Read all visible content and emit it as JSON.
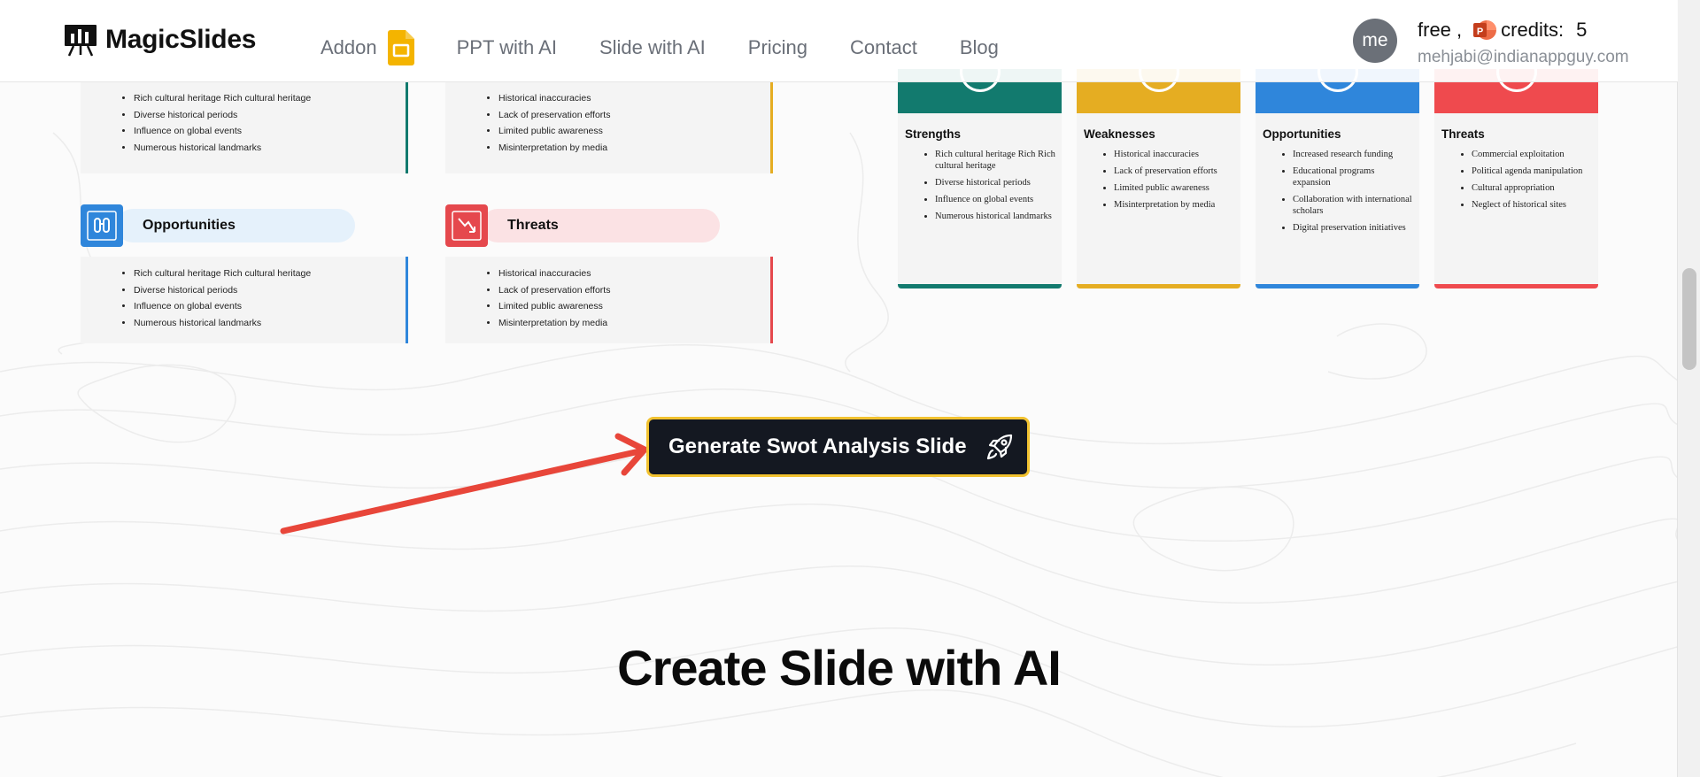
{
  "header": {
    "brand": "MagicSlides",
    "nav": {
      "addon": "Addon",
      "ppt_with_ai": "PPT with AI",
      "slide_with_ai": "Slide with AI",
      "pricing": "Pricing",
      "contact": "Contact",
      "blog": "Blog"
    },
    "avatar": "me",
    "plan": "free ,",
    "credits_label": "credits:",
    "credits_value": "5",
    "email": "mehjabi@indianappguy.com"
  },
  "swot_left": {
    "strengths_items": [
      "Rich cultural heritage Rich cultural heritage",
      "Diverse historical periods",
      "Influence on global events",
      "Numerous historical landmarks"
    ],
    "weaknesses_items": [
      "Historical inaccuracies",
      "Lack of preservation efforts",
      "Limited public awareness",
      "Misinterpretation by media"
    ],
    "opportunities_title": "Opportunities",
    "opportunities_items": [
      "Rich cultural heritage Rich cultural heritage",
      "Diverse historical periods",
      "Influence on global events",
      "Numerous historical landmarks"
    ],
    "threats_title": "Threats",
    "threats_items": [
      "Historical inaccuracies",
      "Lack of preservation efforts",
      "Limited public awareness",
      "Misinterpretation by media"
    ]
  },
  "swot_right": {
    "columns": [
      {
        "title": "Strengths",
        "color": "#127a6e",
        "items": [
          "Rich cultural heritage Rich Rich cultural heritage",
          "Diverse historical periods",
          "Influence on global events",
          "Numerous historical landmarks"
        ]
      },
      {
        "title": "Weaknesses",
        "color": "#e5ad22",
        "items": [
          "Historical inaccuracies",
          "Lack of preservation efforts",
          "Limited public awareness",
          "Misinterpretation by media"
        ]
      },
      {
        "title": "Opportunities",
        "color": "#2f86db",
        "items": [
          "Increased research funding",
          "Educational programs expansion",
          "Collaboration with international scholars",
          "Digital preservation initiatives"
        ]
      },
      {
        "title": "Threats",
        "color": "#ef4a4e",
        "items": [
          "Commercial exploitation",
          "Political agenda manipulation",
          "Cultural appropriation",
          "Neglect of historical sites"
        ]
      }
    ]
  },
  "cta": {
    "label": "Generate Swot Analysis Slide"
  },
  "section": {
    "title": "Create Slide with AI"
  },
  "colors": {
    "strengths": "#127a6e",
    "weaknesses": "#e5ad22",
    "opportunities": "#2f86db",
    "threats": "#ef4a4e",
    "cta_bg": "#141821",
    "cta_border": "#f2c230",
    "arrow": "#e8463a"
  }
}
